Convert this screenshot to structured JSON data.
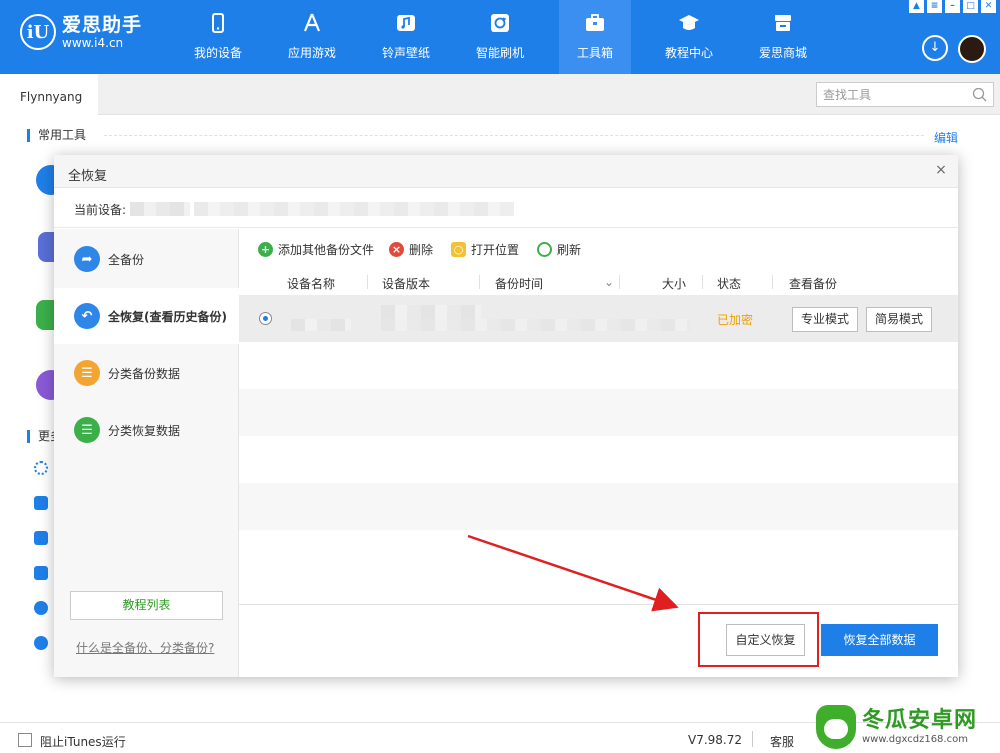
{
  "app": {
    "brand_name": "爱思助手",
    "brand_url": "www.i4.cn",
    "logo_glyph": "iU",
    "accent_color": "#1f7fe8"
  },
  "nav": [
    {
      "label": "我的设备",
      "icon": "phone-icon"
    },
    {
      "label": "应用游戏",
      "icon": "app-store-icon"
    },
    {
      "label": "铃声壁纸",
      "icon": "ringtone-icon"
    },
    {
      "label": "智能刷机",
      "icon": "flash-icon"
    },
    {
      "label": "工具箱",
      "icon": "toolbox-icon",
      "active": true
    },
    {
      "label": "教程中心",
      "icon": "graduation-cap-icon"
    },
    {
      "label": "爱思商城",
      "icon": "store-icon"
    }
  ],
  "window_controls": [
    "shirt-icon",
    "menu-icon",
    "minimize-icon",
    "maximize-icon",
    "close-icon"
  ],
  "tabs": {
    "active_tab": "Flynnyang"
  },
  "search": {
    "placeholder": "查找工具"
  },
  "page": {
    "common_tools_title": "常用工具",
    "edit_label": "编辑",
    "more_tools_title_partial": "更多"
  },
  "modal": {
    "title": "全恢复",
    "close_glyph": "×",
    "current_device_label": "当前设备:",
    "left_menu": [
      {
        "label": "全备份",
        "icon": "backup-icon",
        "color": "#2d86e8"
      },
      {
        "label": "全恢复(查看历史备份)",
        "icon": "restore-icon",
        "color": "#2d86e8",
        "active": true
      },
      {
        "label": "分类备份数据",
        "icon": "category-backup-icon",
        "color": "#f3a531"
      },
      {
        "label": "分类恢复数据",
        "icon": "category-restore-icon",
        "color": "#3bb04a"
      }
    ],
    "tutorial_button": "教程列表",
    "faq_link": "什么是全备份、分类备份?",
    "toolbar": {
      "add": "添加其他备份文件",
      "delete": "删除",
      "open_location": "打开位置",
      "refresh": "刷新"
    },
    "table": {
      "headers": {
        "device_name": "设备名称",
        "device_version": "设备版本",
        "backup_time": "备份时间",
        "size": "大小",
        "status": "状态",
        "view_backup": "查看备份"
      },
      "rows": [
        {
          "status": "已加密",
          "pro_mode": "专业模式",
          "simple_mode": "简易模式",
          "selected": true
        }
      ]
    },
    "custom_restore_button": "自定义恢复",
    "restore_all_button": "恢复全部数据"
  },
  "bottom": {
    "block_itunes_label": "阻止iTunes运行",
    "version": "V7.98.72",
    "service": "客服"
  },
  "watermark": {
    "name": "冬瓜安卓网",
    "url": "www.dgxcdz168.com"
  }
}
